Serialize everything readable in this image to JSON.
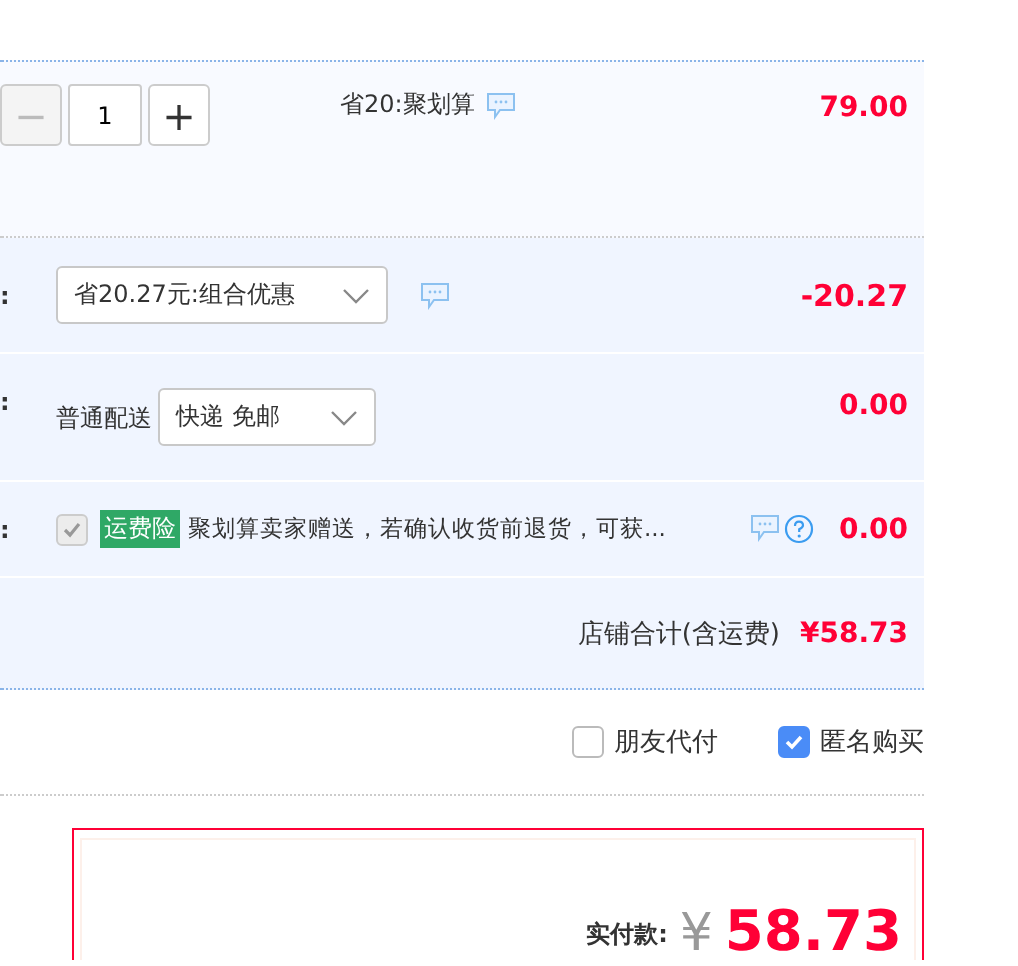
{
  "item": {
    "quantity": "1",
    "minus": "−",
    "plus": "+",
    "promo": "省20:聚划算",
    "price": "79.00"
  },
  "combo": {
    "label": ":",
    "select": "省20.27元:组合优惠",
    "amount": "-20.27"
  },
  "delivery": {
    "label": ":",
    "method": "普通配送",
    "select": "快递 免邮",
    "amount": "0.00"
  },
  "insurance": {
    "label": ":",
    "checked": true,
    "disabled": true,
    "badge": "运费险",
    "text": "聚划算卖家赠送，若确认收货前退货，可获...",
    "amount": "0.00"
  },
  "subtotal": {
    "label": "店铺合计(含运费)",
    "amount": "¥58.73"
  },
  "options": [
    {
      "label": "朋友代付",
      "checked": false
    },
    {
      "label": "匿名购买",
      "checked": true
    }
  ],
  "payment": {
    "label": "实付款:",
    "currency": "¥",
    "amount": "58.73"
  }
}
